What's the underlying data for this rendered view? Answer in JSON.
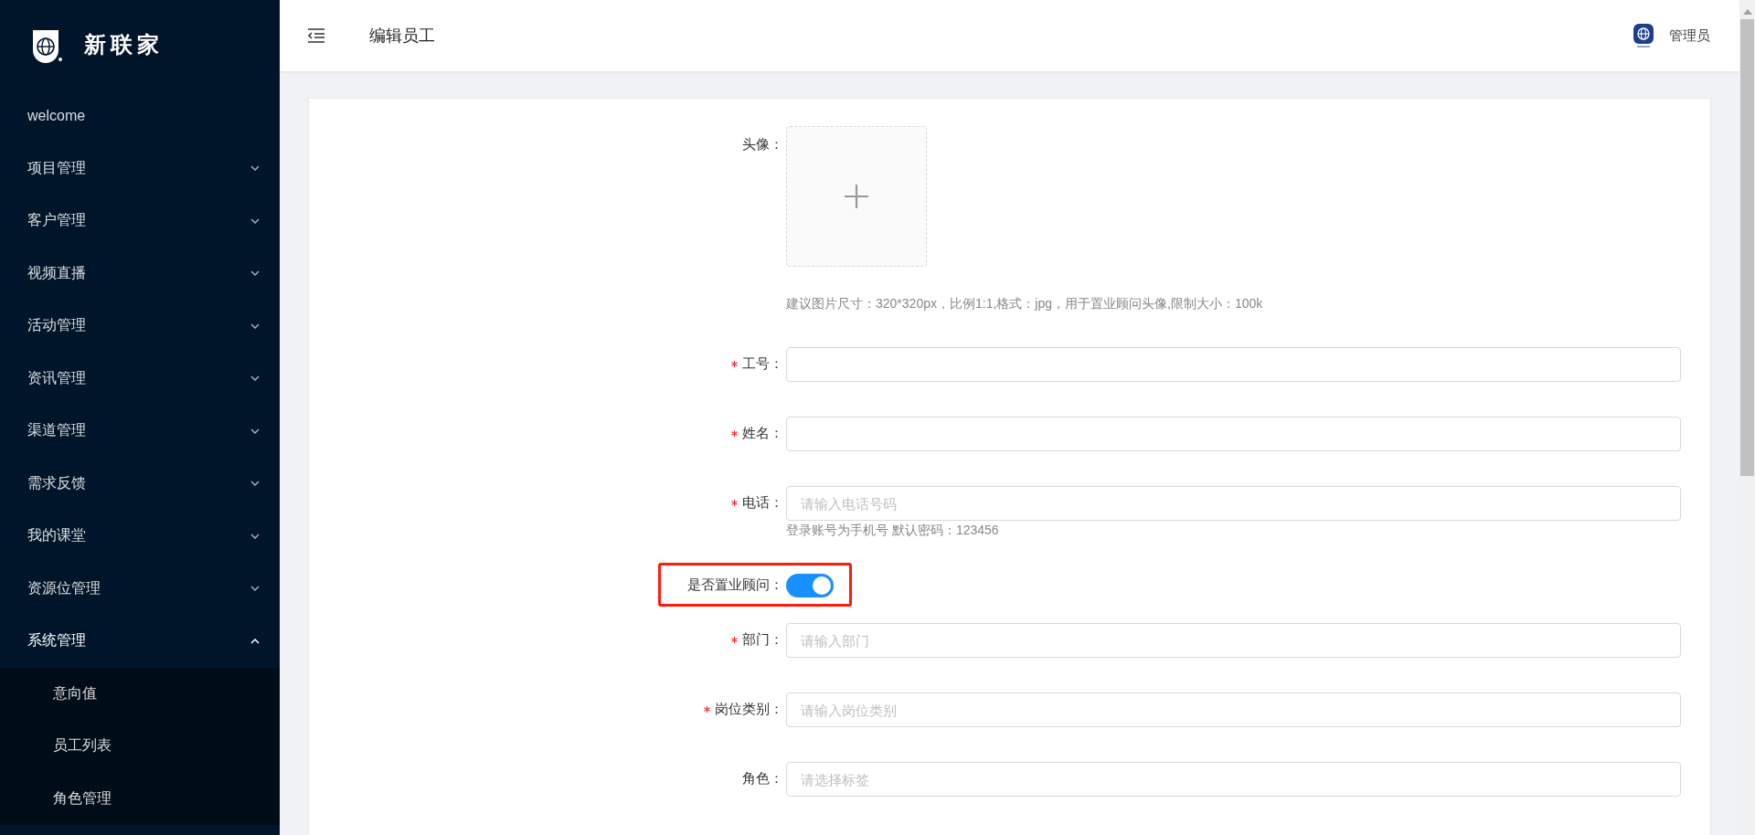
{
  "brand": {
    "name": "新联家"
  },
  "sidebar": {
    "items": [
      {
        "label": "welcome",
        "has_children": false,
        "expanded": false
      },
      {
        "label": "项目管理",
        "has_children": true,
        "expanded": false
      },
      {
        "label": "客户管理",
        "has_children": true,
        "expanded": false
      },
      {
        "label": "视频直播",
        "has_children": true,
        "expanded": false
      },
      {
        "label": "活动管理",
        "has_children": true,
        "expanded": false
      },
      {
        "label": "资讯管理",
        "has_children": true,
        "expanded": false
      },
      {
        "label": "渠道管理",
        "has_children": true,
        "expanded": false
      },
      {
        "label": "需求反馈",
        "has_children": true,
        "expanded": false
      },
      {
        "label": "我的课堂",
        "has_children": true,
        "expanded": false
      },
      {
        "label": "资源位管理",
        "has_children": true,
        "expanded": false
      },
      {
        "label": "系统管理",
        "has_children": true,
        "expanded": true,
        "children": [
          {
            "label": "意向值"
          },
          {
            "label": "员工列表"
          },
          {
            "label": "角色管理"
          }
        ]
      }
    ]
  },
  "header": {
    "title": "编辑员工",
    "user": "管理员"
  },
  "form": {
    "fields": [
      {
        "kind": "upload",
        "label": "头像：",
        "required": false,
        "hint": "建议图片尺寸：320*320px，比例1:1,格式：jpg，用于置业顾问头像,限制大小：100k"
      },
      {
        "kind": "input",
        "label": "工号：",
        "required": true
      },
      {
        "kind": "input",
        "label": "姓名：",
        "required": true
      },
      {
        "kind": "input",
        "label": "电话：",
        "required": true,
        "placeholder": "请输入电话号码",
        "hint": "登录账号为手机号 默认密码：123456"
      },
      {
        "kind": "switch",
        "label": "是否置业顾问：",
        "required": false,
        "on": true,
        "highlighted": true
      },
      {
        "kind": "input",
        "label": "部门：",
        "required": true,
        "placeholder": "请输入部门"
      },
      {
        "kind": "input",
        "label": "岗位类别：",
        "required": true,
        "placeholder": "请输入岗位类别"
      },
      {
        "kind": "input",
        "label": "角色：",
        "required": false,
        "placeholder": "请选择标签"
      }
    ]
  }
}
